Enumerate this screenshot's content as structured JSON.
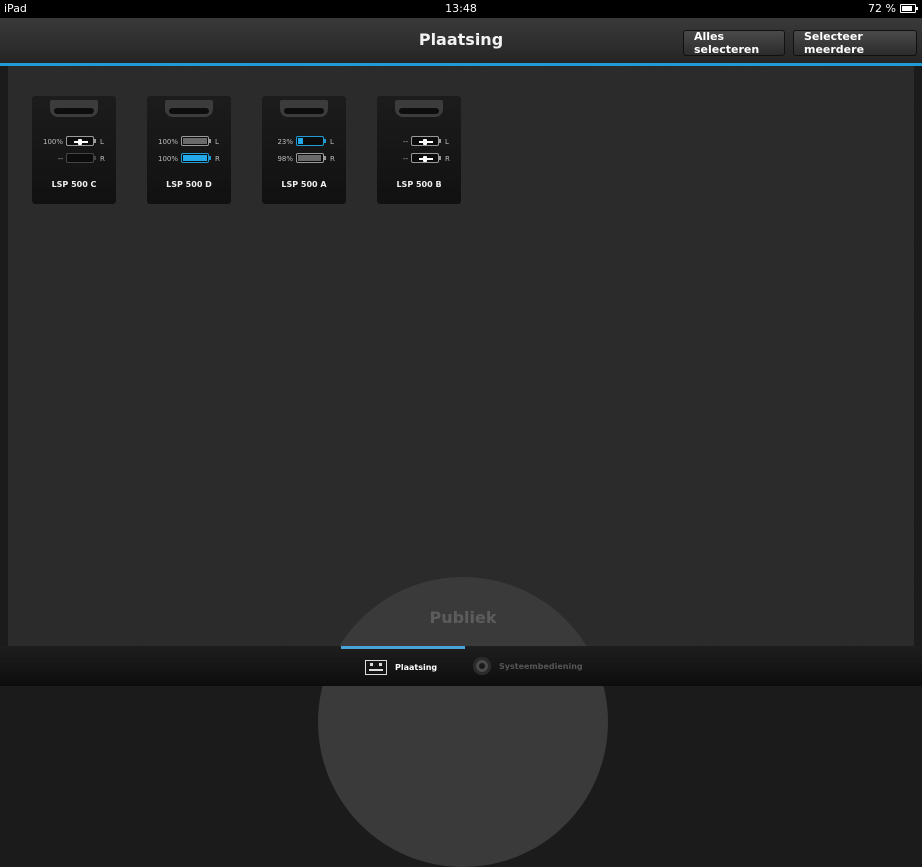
{
  "status_bar": {
    "device": "iPad",
    "time": "13:48",
    "battery": "72 %"
  },
  "header": {
    "title": "Plaatsing",
    "select_all_label": "Alles selecteren",
    "select_multiple_label": "Selecteer meerdere"
  },
  "devices": [
    {
      "name": "LSP 500 C",
      "left": {
        "percent": "100%",
        "state": "plug",
        "side": "L"
      },
      "right": {
        "percent": "--",
        "state": "empty",
        "side": "R"
      }
    },
    {
      "name": "LSP 500 D",
      "left": {
        "percent": "100%",
        "state": "full",
        "side": "L"
      },
      "right": {
        "percent": "100%",
        "state": "charging",
        "side": "R"
      }
    },
    {
      "name": "LSP 500 A",
      "left": {
        "percent": "23%",
        "state": "low-charging",
        "side": "L"
      },
      "right": {
        "percent": "98%",
        "state": "full",
        "side": "R"
      }
    },
    {
      "name": "LSP 500 B",
      "left": {
        "percent": "--",
        "state": "plug",
        "side": "L"
      },
      "right": {
        "percent": "--",
        "state": "plug",
        "side": "R"
      }
    }
  ],
  "audience_zone": {
    "label": "Publiek"
  },
  "tabs": [
    {
      "label": "Plaatsing",
      "icon": "placement-icon",
      "active": true
    },
    {
      "label": "Systeembediening",
      "icon": "gear-icon",
      "active": false
    }
  ],
  "colors": {
    "accent": "#1f9bd6",
    "background": "#2a2a2a"
  }
}
